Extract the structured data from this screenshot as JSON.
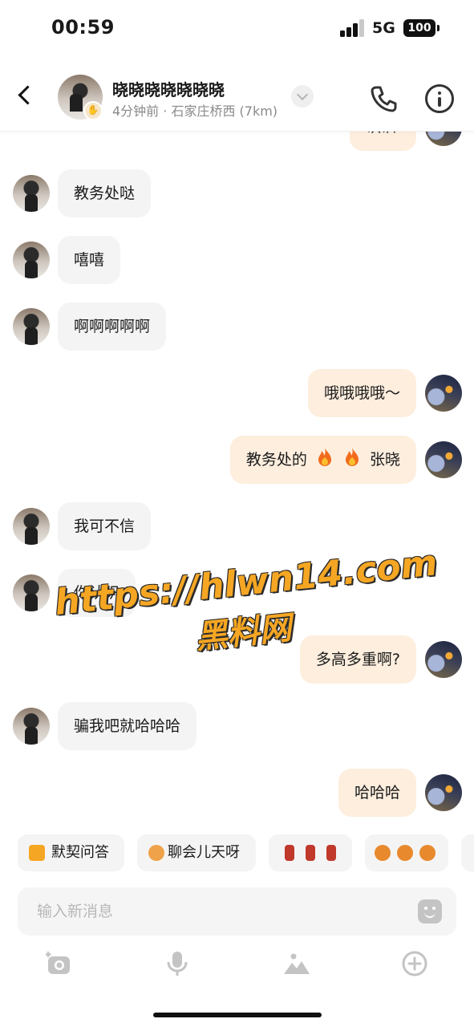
{
  "status_bar": {
    "time": "00:59",
    "network": "5G",
    "battery": "100"
  },
  "header": {
    "contact_name": "晓晓晓晓晓晓晓",
    "contact_sub": "4分钟前 · 石家庄桥西 (7km)",
    "avatar_badge_icon": "wave-hand-icon"
  },
  "messages": [
    {
      "side": "out",
      "text": "认识"
    },
    {
      "side": "in",
      "text": "教务处哒"
    },
    {
      "side": "in",
      "text": "嘻嘻"
    },
    {
      "side": "in",
      "text": "啊啊啊啊啊"
    },
    {
      "side": "out",
      "text": "哦哦哦哦～"
    },
    {
      "side": "out",
      "text": "教务处的",
      "emoji": [
        "fire-icon",
        "fire-icon"
      ],
      "tail": "张晓"
    },
    {
      "side": "in",
      "text": "我可不信"
    },
    {
      "side": "in",
      "text": "你认识"
    },
    {
      "side": "out",
      "text": "多高多重啊?"
    },
    {
      "side": "in",
      "text": "骗我吧就哈哈哈"
    },
    {
      "side": "out",
      "text": "哈哈哈"
    }
  ],
  "watermark": {
    "line1": "https://hlwn14.com",
    "line2": "黑料网"
  },
  "quick_replies": [
    {
      "label": "默契问答",
      "icon": "pencil-note-icon"
    },
    {
      "label": "聊会儿天呀",
      "icon": "chat-face-icon"
    },
    {
      "label": "",
      "icon": "firecracker-stickers"
    },
    {
      "label": "",
      "icon": "paw-face-stickers"
    },
    {
      "label": "",
      "icon": "more-chip"
    }
  ],
  "input": {
    "placeholder": "输入新消息"
  },
  "toolbar": [
    "camera-icon",
    "microphone-icon",
    "image-icon",
    "plus-circle-icon"
  ],
  "colors": {
    "bubble_in": "#f4f4f4",
    "bubble_out": "#fdeede",
    "watermark": "#f5a623",
    "accent_icon": "#f5a623"
  }
}
